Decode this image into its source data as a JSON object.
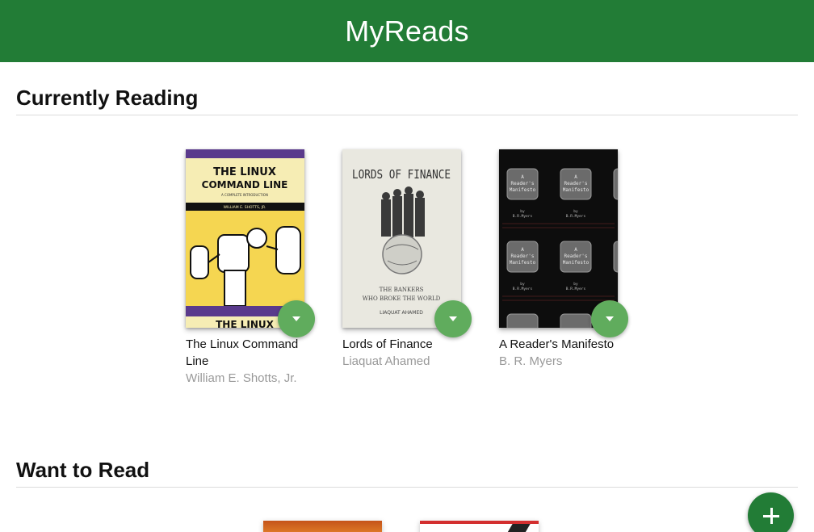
{
  "app": {
    "title": "MyReads"
  },
  "shelves": [
    {
      "title": "Currently Reading",
      "books": [
        {
          "title": "The Linux Command Line",
          "authors": "William E. Shotts, Jr.",
          "cover": "linux-cover"
        },
        {
          "title": "Lords of Finance",
          "authors": "Liaquat Ahamed",
          "cover": "finance-cover"
        },
        {
          "title": "A Reader's Manifesto",
          "authors": "B. R. Myers",
          "cover": "manifesto-cover"
        }
      ]
    },
    {
      "title": "Want to Read",
      "books": []
    }
  ],
  "covers": {
    "linux": {
      "line1": "THE LINUX",
      "line2": "COMMAND LINE",
      "sub": "A COMPLETE INTRODUCTION",
      "author": "WILLIAM E. SHOTTS, JR.",
      "bottom": "THE LINUX"
    },
    "finance": {
      "title": "LORDS OF FINANCE",
      "sub1": "THE BANKERS",
      "sub2": "WHO BROKE THE WORLD",
      "author": "LIAQUAT AHAMED"
    },
    "manifesto": {
      "label1": "A",
      "label2": "Reader's",
      "label3": "Manifesto",
      "by": "by",
      "author": "B.R.Myers"
    }
  },
  "icons": {
    "shelf_changer": "chevron-down-icon",
    "add": "plus-icon"
  },
  "colors": {
    "header": "#227c36",
    "changer": "#60ac5d",
    "add_button": "#227c36",
    "author_text": "#999999"
  }
}
